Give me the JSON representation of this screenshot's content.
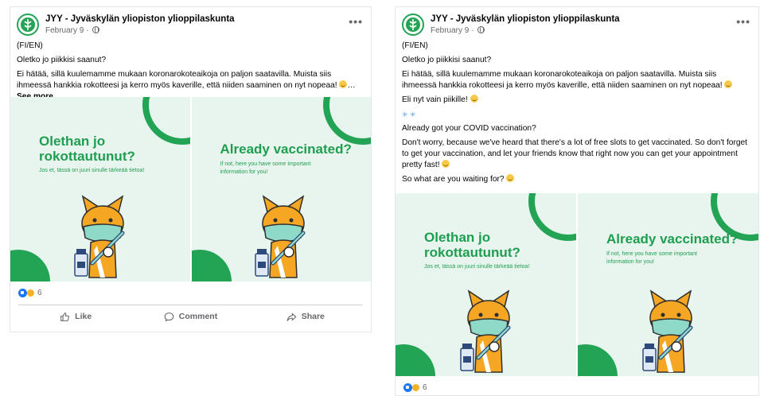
{
  "left_post": {
    "author": "JYY - Jyväskylän yliopiston ylioppilaskunta",
    "date": "February 9 ·",
    "lines": [
      "(FI/EN)",
      "Oletko jo piikkisi saanut?",
      "Ei hätää, sillä kuulemamme mukaan koronarokoteaikoja on paljon saatavilla. Muista siis ihmeessä hankkia rokotteesi ja kerro myös kaverille, että niiden saaminen on nyt nopeaa!"
    ],
    "ellipsis": "…",
    "see_more": "See more",
    "panel_fi": {
      "title_line1": "Olethan jo",
      "title_line2": "rokottautunut?",
      "subtitle": "Jos et, tässä on juuri sinulle tärkeää tietoa!"
    },
    "panel_en": {
      "title": "Already vaccinated?",
      "subtitle_line1": "If not, here you have some important",
      "subtitle_line2": "information for you!"
    },
    "reaction_count": "6",
    "actions": {
      "like": "Like",
      "comment": "Comment",
      "share": "Share"
    }
  },
  "right_post": {
    "author": "JYY - Jyväskylän yliopiston ylioppilaskunta",
    "date": "February 9 ·",
    "lines": [
      "(FI/EN)",
      "Oletko jo piikkisi saanut?",
      "Ei hätää, sillä kuulemamme mukaan koronarokoteaikoja on paljon saatavilla. Muista siis ihmeessä hankkia rokotteesi ja kerro myös kaverille, että niiden saaminen on nyt nopeaa!",
      "Eli nyt vain piikille!",
      "Already got your COVID vaccination?",
      "Don't worry, because we've heard that there's a lot of free slots to get vaccinated. So don't forget to get your vaccination, and let your friends know that right now you can get your appointment pretty fast!",
      "So what are you waiting for?"
    ],
    "panel_fi": {
      "title_line1": "Olethan jo",
      "title_line2": "rokottautunut?",
      "subtitle": "Jos et, tässä on juuri sinulle tärkeää tietoa!"
    },
    "panel_en": {
      "title": "Already vaccinated?",
      "subtitle_line1": "If not, here you have some important",
      "subtitle_line2": "information for you!"
    },
    "reaction_count": "6"
  },
  "colors": {
    "brand_green": "#23a455",
    "panel_bg": "#e8f5ef",
    "mascot_orange": "#f5a623",
    "mask_teal": "#8fd9c8",
    "like_blue": "#1877f2"
  },
  "icons": [
    "jyy-logo-icon",
    "globe-icon",
    "more-options-icon",
    "like-reaction-icon",
    "care-reaction-icon",
    "thumbs-up-icon",
    "comment-icon",
    "share-icon",
    "sparkle-icon"
  ]
}
